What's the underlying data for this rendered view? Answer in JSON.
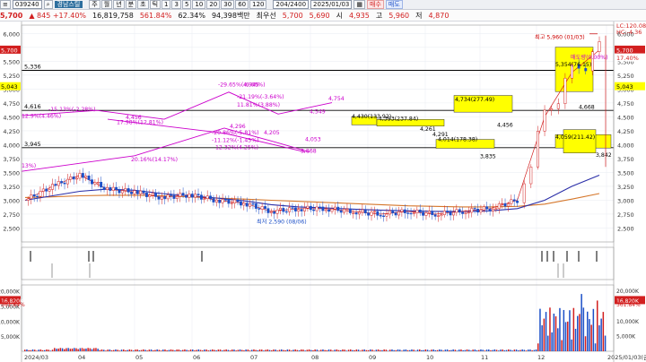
{
  "toolbar": {
    "code": "039240",
    "name": "경남스틸",
    "periods": [
      "주",
      "월",
      "년",
      "분",
      "초",
      "틱",
      "1",
      "3",
      "5",
      "10",
      "20",
      "30",
      "60",
      "120"
    ],
    "range": "204/2400",
    "date": "2025/01/03",
    "buy_label": "매수",
    "sell_label": "매도"
  },
  "quote": {
    "price": "5,700",
    "change": "▲ 845 +17.40%",
    "volume": "16,819,758",
    "vol_ratio": "561.84%",
    "turnover": "62.34%",
    "amount": "94,398백만",
    "bid_label": "최우선",
    "bid": "5,700",
    "ask": "5,690",
    "open_label": "시",
    "open": "4,935",
    "high_label": "고",
    "high": "5,960",
    "low_label": "저",
    "low": "4,870"
  },
  "colors": {
    "up": "#d21f1f",
    "down": "#1c4fc7",
    "ma5": "#d21f1f",
    "ma20": "#2a2ea8",
    "ma60": "#d5762a",
    "trend": "#cc00cc",
    "box": "#ffff00",
    "hline": "#000000"
  },
  "chart_data": [
    {
      "type": "candlestick",
      "price_scale": {
        "min": 2250,
        "max": 6150
      },
      "y_ticks": [
        "6,000",
        "5,750",
        "5,500",
        "5,250",
        "5,000",
        "4,750",
        "4,500",
        "4,250",
        "4,000",
        "3,750",
        "3,500",
        "3,250",
        "3,000",
        "2,750",
        "2,500"
      ],
      "x_ticks": [
        "2024/03",
        "04",
        "05",
        "06",
        "07",
        "08",
        "09",
        "10",
        "11",
        "12",
        "2025/01/03(금)"
      ],
      "series": [
        {
          "name": "close",
          "x": [
            "2024-03",
            "2024-04",
            "2024-04b",
            "2024-05",
            "2024-05b",
            "2024-06",
            "2024-06b",
            "2024-07",
            "2024-07b",
            "2024-08",
            "2024-08b",
            "2024-09",
            "2024-09b",
            "2024-10",
            "2024-10b",
            "2024-11",
            "2024-11b",
            "2024-12",
            "2024-12b",
            "2024-12c",
            "2024-12d",
            "2025-01"
          ],
          "values": [
            3000,
            3250,
            3450,
            3200,
            3150,
            3050,
            3100,
            3000,
            2950,
            2800,
            2850,
            2850,
            2800,
            2750,
            2800,
            2750,
            2800,
            2850,
            3000,
            4500,
            5300,
            5700
          ]
        },
        {
          "name": "ma20",
          "values": [
            3000,
            3080,
            3160,
            3200,
            3180,
            3120,
            3080,
            3040,
            2990,
            2920,
            2880,
            2860,
            2840,
            2820,
            2810,
            2800,
            2800,
            2810,
            2850,
            3000,
            3250,
            3450
          ]
        },
        {
          "name": "ma60",
          "values": [
            3050,
            3060,
            3080,
            3090,
            3090,
            3080,
            3060,
            3040,
            3020,
            3000,
            2980,
            2960,
            2940,
            2920,
            2900,
            2890,
            2880,
            2880,
            2890,
            2930,
            3020,
            3120
          ]
        }
      ],
      "h_lines": [
        {
          "value": 5336,
          "label": "5,336"
        },
        {
          "value": 4616,
          "label": "4,616"
        },
        {
          "value": 3945,
          "label": "3,945"
        }
      ],
      "right_axis_labels": [
        {
          "text": "5,700",
          "value": 5700,
          "bg": "#d21f1f",
          "color": "#ffffff"
        },
        {
          "text": "17.40%",
          "value": 5560,
          "bg": "#ffffff",
          "color": "#d21f1f"
        },
        {
          "text": "5,043",
          "value": 5043,
          "bg": "#ffff00",
          "color": "#000000"
        }
      ],
      "right_margin_labels": [
        {
          "text": "LC:120.08",
          "value": 6100
        },
        {
          "text": "HC:-4.36",
          "value": 5990
        }
      ],
      "left_axis_labels": [
        {
          "text": "5,700",
          "value": 5700,
          "bg": "#d21f1f",
          "color": "#ffffff"
        },
        {
          "text": "5,043",
          "value": 5043,
          "bg": "#ffff00",
          "color": "#000000"
        }
      ],
      "annotations": [
        {
          "text": "최고 5,960 (01/03)",
          "color": "#cc0000"
        },
        {
          "text": "최저 2,590 (08/06)",
          "color": "#1c4fc7"
        },
        {
          "text": "-29.65%(-6.66%)",
          "color": "#cc00cc"
        },
        {
          "text": "4,945",
          "color": "#cc00cc"
        },
        {
          "text": "-21.19%(-3.64%)",
          "color": "#cc00cc"
        },
        {
          "text": "11.81%(3.88%)",
          "color": "#cc00cc"
        },
        {
          "text": "4,754",
          "color": "#cc00cc"
        },
        {
          "text": "4,549",
          "color": "#cc00cc"
        },
        {
          "text": "4,456",
          "color": "#cc00cc"
        },
        {
          "text": "17.98%(12.81%)",
          "color": "#cc00cc"
        },
        {
          "text": "-15.13%(-2.28%)",
          "color": "#cc00cc"
        },
        {
          "text": "12.9%(4.46%)",
          "color": "#cc00cc"
        },
        {
          "text": "4,296",
          "color": "#cc00cc"
        },
        {
          "text": "-20.86%(-5.81%)",
          "color": "#cc00cc"
        },
        {
          "text": "4,205",
          "color": "#cc00cc"
        },
        {
          "text": "-11.12%(-1.45%)",
          "color": "#cc00cc"
        },
        {
          "text": "12.32%(4.25%)",
          "color": "#cc00cc"
        },
        {
          "text": "4,053",
          "color": "#cc00cc"
        },
        {
          "text": "3,868",
          "color": "#cc00cc"
        },
        {
          "text": "20.16%(14.17%)",
          "color": "#cc00cc"
        },
        {
          "text": "13%)",
          "color": "#cc00cc"
        },
        {
          "text": "4,430(133.92)",
          "color": "#000000"
        },
        {
          "text": "4,393(237.84)",
          "color": "#000000"
        },
        {
          "text": "4,734(277.49)",
          "color": "#000000"
        },
        {
          "text": "4,456",
          "color": "#000000"
        },
        {
          "text": "4,291",
          "color": "#000000"
        },
        {
          "text": "4,261",
          "color": "#000000"
        },
        {
          "text": "4,014(178.38)",
          "color": "#000000"
        },
        {
          "text": "3,835",
          "color": "#000000"
        },
        {
          "text": "4,059(211.42)",
          "color": "#000000"
        },
        {
          "text": "3,842",
          "color": "#000000"
        },
        {
          "text": "5,354(76.15)",
          "color": "#000000"
        },
        {
          "text": "매도량(0.00%)",
          "color": "#cc00cc"
        },
        {
          "text": "4,668",
          "color": "#000000"
        }
      ]
    },
    {
      "type": "bar",
      "name": "volume",
      "y_ticks": [
        "20,000K",
        "15,000K",
        "10,000K",
        "5,000K"
      ],
      "right_labels": [
        "20,000K",
        "16,820K",
        "561.84%",
        "10,000K",
        "5,000K"
      ],
      "left_labels": [
        "16,820K",
        "561.84%"
      ]
    }
  ]
}
